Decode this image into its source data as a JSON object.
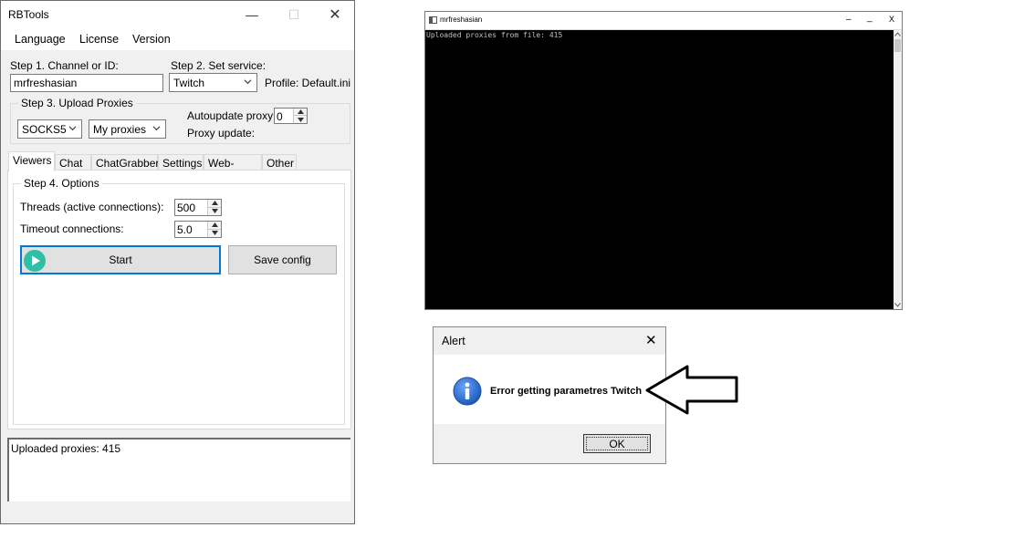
{
  "main_window": {
    "title": "RBTools",
    "controls": {
      "minimize": "—",
      "maximize": "☐",
      "close": "✕"
    },
    "menu": [
      "Language",
      "License",
      "Version"
    ],
    "step1_label": "Step 1. Channel or ID:",
    "channel_value": "mrfreshasian",
    "step2_label": "Step 2. Set service:",
    "service_value": "Twitch",
    "profile_label": "Profile: Default.ini",
    "step3_label": "Step 3. Upload Proxies",
    "proxy_type_value": "SOCKS5",
    "proxy_source_value": "My proxies",
    "autoupdate_label": "Autoupdate proxy:",
    "autoupdate_value": "0",
    "proxy_update_label": "Proxy update:",
    "tabs": [
      "Viewers",
      "Chat",
      "ChatGrabber",
      "Settings",
      "Web-panel",
      "Other"
    ],
    "active_tab": "Viewers",
    "step4_label": "Step 4. Options",
    "threads_label": "Threads (active connections):",
    "threads_value": "500",
    "timeout_label": "Timeout connections:",
    "timeout_value": "5.0",
    "start_label": "Start",
    "save_config_label": "Save config",
    "log_text": "Uploaded proxies: 415"
  },
  "console_window": {
    "title": "mrfreshasian",
    "controls": {
      "minimize": "–",
      "maximize": "_",
      "close": "X"
    },
    "text": "Uploaded proxies from file: 415"
  },
  "alert_dialog": {
    "title": "Alert",
    "close": "✕",
    "message": "Error getting parametres Twitch",
    "ok_label": "OK"
  },
  "colors": {
    "play_icon": "#2fbfa6",
    "info_icon": "#1e5bb8",
    "start_border": "#0078d7",
    "console_bg": "#000000"
  }
}
